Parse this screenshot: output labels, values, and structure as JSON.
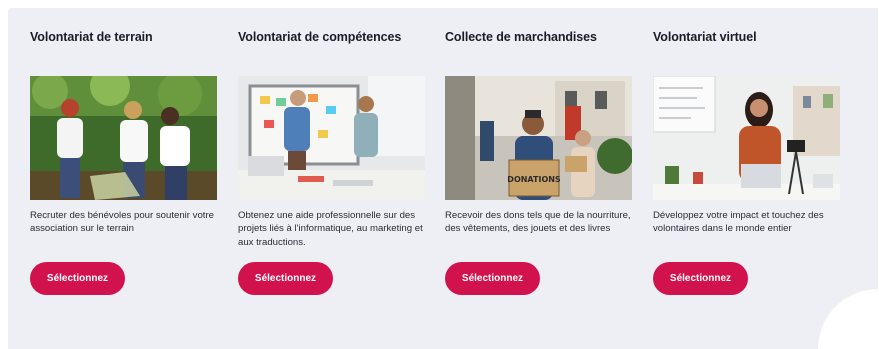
{
  "cards": [
    {
      "title": "Volontariat de terrain",
      "description": "Recruter des bénévoles pour soutenir votre association sur le terrain",
      "button_label": "Sélectionnez",
      "photo": "volunteers-picking-litter-photo"
    },
    {
      "title": "Volontariat de compétences",
      "description": "Obtenez une aide professionnelle sur des projets liés à l'informatique, au marketing et aux traductions.",
      "button_label": "Sélectionnez",
      "photo": "office-whiteboard-meeting-photo"
    },
    {
      "title": "Collecte de marchandises",
      "description": "Recevoir des dons tels que de la nourriture, des vêtements, des jouets et des livres",
      "button_label": "Sélectionnez",
      "photo": "donation-box-street-photo",
      "photo_sign_text": "DONATIONS"
    },
    {
      "title": "Volontariat virtuel",
      "description": "Développez votre impact et touchez des volontaires dans le monde entier",
      "button_label": "Sélectionnez",
      "photo": "woman-recording-video-photo"
    }
  ],
  "colors": {
    "panel_background": "#eeeef5",
    "button": "#d1124d",
    "button_text": "#ffffff",
    "title_text": "#1c1c28"
  }
}
